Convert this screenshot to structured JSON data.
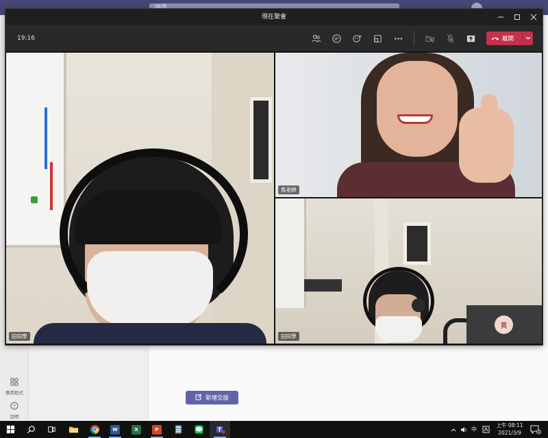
{
  "teams": {
    "search_placeholder": "搜尋",
    "rail": [
      {
        "icon": "apps-icon",
        "label": "應用程式"
      },
      {
        "icon": "help-icon",
        "label": "說明"
      }
    ],
    "new_chat_label": "新增交談"
  },
  "meeting": {
    "window_title": "現在聚會",
    "elapsed_time": "19:16",
    "toolbar": {
      "icons": [
        "participants-icon",
        "chat-icon",
        "reactions-icon",
        "rooms-icon",
        "more-options-icon",
        "camera-off-icon",
        "mic-off-icon",
        "share-icon"
      ],
      "leave_label": "離開"
    },
    "participants": [
      {
        "name": "田同學"
      },
      {
        "name": "馬老師"
      },
      {
        "name": "田同學"
      }
    ],
    "avatar_initial": "黃"
  },
  "taskbar": {
    "apps": [
      "start-icon",
      "search-icon",
      "task-view-icon",
      "file-explorer-icon",
      "chrome-icon",
      "word-icon",
      "excel-icon",
      "powerpoint-icon",
      "calculator-icon",
      "line-icon",
      "teams-icon"
    ],
    "ime_label": "中",
    "time": "上午 08:11",
    "date": "2021/3/9",
    "notification_count": "4"
  },
  "colors": {
    "teams_purple": "#464775",
    "accent": "#6264a7",
    "leave_red": "#c4314b"
  }
}
